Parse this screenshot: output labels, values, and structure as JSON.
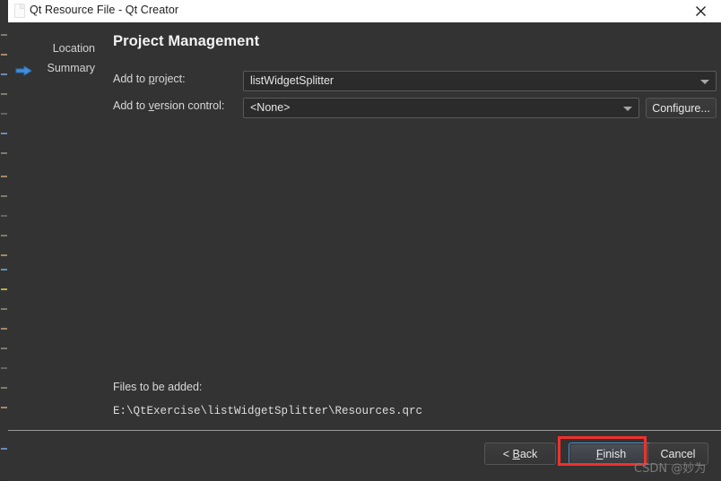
{
  "window": {
    "title": "Qt Resource File - Qt Creator",
    "icon": "file-document-icon",
    "close_label": "✕",
    "titlebar_bg": "#ffffff",
    "body_bg": "#333333"
  },
  "wizard": {
    "steps": [
      {
        "label": "Location",
        "active": false
      },
      {
        "label": "Summary",
        "active": true
      }
    ],
    "active_arrow_icon": "blue-arrow-right-icon",
    "active_arrow_color": "#3f8fe0"
  },
  "page": {
    "title": "Project Management",
    "fields": [
      {
        "id": "add-to-project",
        "label_prefix": "Add to ",
        "label_mnemonic": "p",
        "label_suffix": "roject:",
        "value": "listWidgetSplitter",
        "placeholder": "",
        "has_dropdown": true,
        "trailing_button": null
      },
      {
        "id": "add-to-version-control",
        "label_prefix": "Add to ",
        "label_mnemonic": "v",
        "label_suffix": "ersion control:",
        "value": "<None>",
        "placeholder": "",
        "has_dropdown": true,
        "trailing_button": "Configure..."
      }
    ],
    "files_label": "Files to be added:",
    "files_path": "E:\\QtExercise\\listWidgetSplitter\\Resources.qrc"
  },
  "footer": {
    "buttons": [
      {
        "id": "back",
        "prefix": "< ",
        "mnemonic": "B",
        "suffix": "ack",
        "primary": false
      },
      {
        "id": "finish",
        "prefix": "",
        "mnemonic": "F",
        "suffix": "inish",
        "primary": true
      },
      {
        "id": "cancel",
        "prefix": "Cancel",
        "mnemonic": "",
        "suffix": "",
        "primary": false
      }
    ]
  },
  "annotation": {
    "color": "#f0312d",
    "target": "finish-button"
  },
  "watermark": {
    "text": "CSDN @妙为"
  }
}
